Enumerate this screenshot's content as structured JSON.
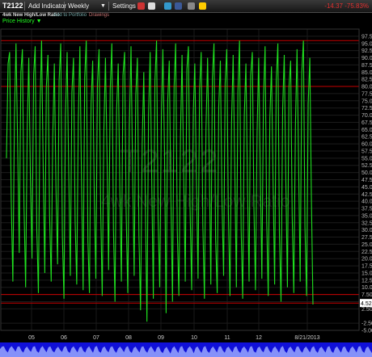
{
  "toolbar": {
    "ticker": "T2122",
    "add_indicator": "Add Indicator",
    "period": "Weekly",
    "settings": "Settings",
    "change": "-14.37  -75.83%",
    "icons": [
      "refresh-icon",
      "print-icon",
      "twitter-icon",
      "facebook-icon",
      "link-icon",
      "note-icon"
    ]
  },
  "subbar": {
    "name": "4wk New High/Low Ratio",
    "portfolio": "Add to Portfolio",
    "drawings": "Drawings"
  },
  "price_history_label": "Price History",
  "watermark": {
    "symbol": "T2122",
    "name": "4wk New High/Low Ratio"
  },
  "colors": {
    "series": "#1fe01f",
    "ref_lines": "#c80000",
    "navigator": "#1010d8",
    "last_price_bg": "#ffffff"
  },
  "chart_data": {
    "type": "line",
    "title": "",
    "xlabel": "",
    "ylabel": "",
    "ylim": [
      -5,
      100
    ],
    "y_ticks": [
      -5,
      -2.5,
      2.5,
      5,
      7.5,
      10,
      12.5,
      15,
      17.5,
      20,
      22.5,
      25,
      27.5,
      30,
      32.5,
      35,
      37.5,
      40,
      42.5,
      45,
      47.5,
      50,
      52.5,
      55,
      57.5,
      60,
      62.5,
      65,
      67.5,
      70,
      72.5,
      75,
      77.5,
      80,
      82.5,
      85,
      87.5,
      90,
      92.5,
      95,
      97.5
    ],
    "x_ticks": [
      "05",
      "06",
      "07",
      "08",
      "09",
      "10",
      "11",
      "12",
      "8/21/2013"
    ],
    "x_range": [
      "2004-06",
      "2013-09"
    ],
    "reference_lines": [
      96,
      80,
      7.5,
      4.5
    ],
    "last_value": "4.52",
    "grid": true,
    "series": [
      {
        "values": [
          55,
          88,
          92,
          40,
          12,
          70,
          95,
          60,
          22,
          85,
          93,
          38,
          10,
          66,
          90,
          48,
          20,
          84,
          94,
          30,
          8,
          72,
          96,
          52,
          15,
          80,
          91,
          35,
          12,
          62,
          88,
          45,
          18,
          82,
          95,
          28,
          6,
          70,
          92,
          50,
          14,
          78,
          90,
          33,
          11,
          68,
          94,
          47,
          9,
          83,
          96,
          26,
          8,
          74,
          89,
          41,
          13,
          81,
          93,
          37,
          7,
          64,
          90,
          55,
          16,
          79,
          95,
          30,
          5,
          72,
          88,
          44,
          12,
          84,
          92,
          36,
          8,
          66,
          94,
          52,
          14,
          77,
          90,
          28,
          2,
          60,
          85,
          40,
          -2,
          70,
          92,
          48,
          6,
          82,
          96,
          34,
          10,
          68,
          93,
          58,
          1,
          75,
          89,
          42,
          5,
          80,
          95,
          30,
          7,
          63,
          91,
          50,
          12,
          86,
          94,
          38,
          9,
          71,
          88,
          46,
          13,
          79,
          92,
          32,
          6,
          65,
          90,
          55,
          11,
          83,
          95,
          27,
          8,
          73,
          89,
          40,
          14,
          81,
          93,
          36,
          7,
          67,
          91,
          52,
          10,
          78,
          96,
          30,
          6,
          70,
          88,
          44,
          12,
          84,
          92,
          38,
          9,
          64,
          90,
          50,
          13,
          76,
          94,
          33,
          7,
          69,
          87,
          46,
          11,
          82,
          95,
          29,
          5,
          72,
          91,
          48,
          10,
          80,
          89,
          35,
          8,
          66,
          93,
          54,
          12,
          85,
          96,
          31,
          7,
          74,
          90,
          42,
          4
        ]
      }
    ]
  }
}
